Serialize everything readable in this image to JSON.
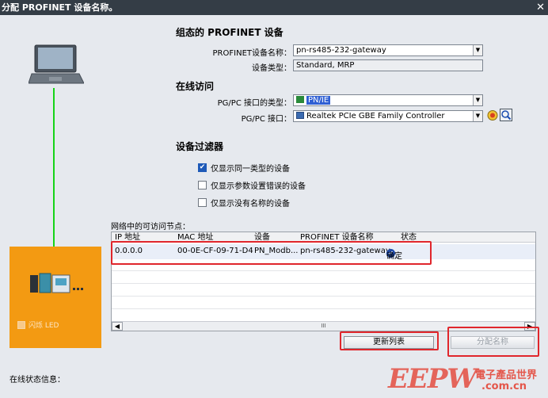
{
  "window": {
    "title": "分配 PROFINET 设备名称。",
    "close_glyph": "✕"
  },
  "configured": {
    "title": "组态的 PROFINET 设备",
    "name_label": "PROFINET设备名称：",
    "name_value": "pn-rs485-232-gateway",
    "type_label": "设备类型：",
    "type_value": "Standard, MRP"
  },
  "online": {
    "title": "在线访问",
    "iface_type_label": "PG/PC 接口的类型：",
    "iface_type_value": "PN/IE",
    "iface_label": "PG/PC 接口：",
    "iface_value": "Realtek PCIe GBE Family Controller"
  },
  "filter": {
    "title": "设备过滤器",
    "options": [
      {
        "label": "仅显示同一类型的设备",
        "checked": true
      },
      {
        "label": "仅显示参数设置错误的设备",
        "checked": false
      },
      {
        "label": "仅显示没有名称的设备",
        "checked": false
      }
    ]
  },
  "nodes": {
    "label": "网络中的可访问节点：",
    "columns": [
      "IP 地址",
      "MAC 地址",
      "设备",
      "PROFINET 设备名称",
      "状态"
    ],
    "rows": [
      {
        "ip": "0.0.0.0",
        "mac": "00-0E-CF-09-71-D4",
        "device": "PN_Modb...",
        "name": "pn-rs485-232-gateway",
        "status": "确定"
      }
    ],
    "scroll_mid": "III"
  },
  "buttons": {
    "refresh": "更新列表",
    "assign": "分配名称"
  },
  "device_panel": {
    "flash_label": "闪烁 LED"
  },
  "status": {
    "label": "在线状态信息："
  },
  "logo": {
    "text": "EEPW",
    "cn_text": "電子產品世界",
    "domain": ".com.cn"
  },
  "colors": {
    "title_bar": "#343d46",
    "device_panel": "#f39a12",
    "link_line": "#17d417",
    "annotation": "#e0262c"
  }
}
